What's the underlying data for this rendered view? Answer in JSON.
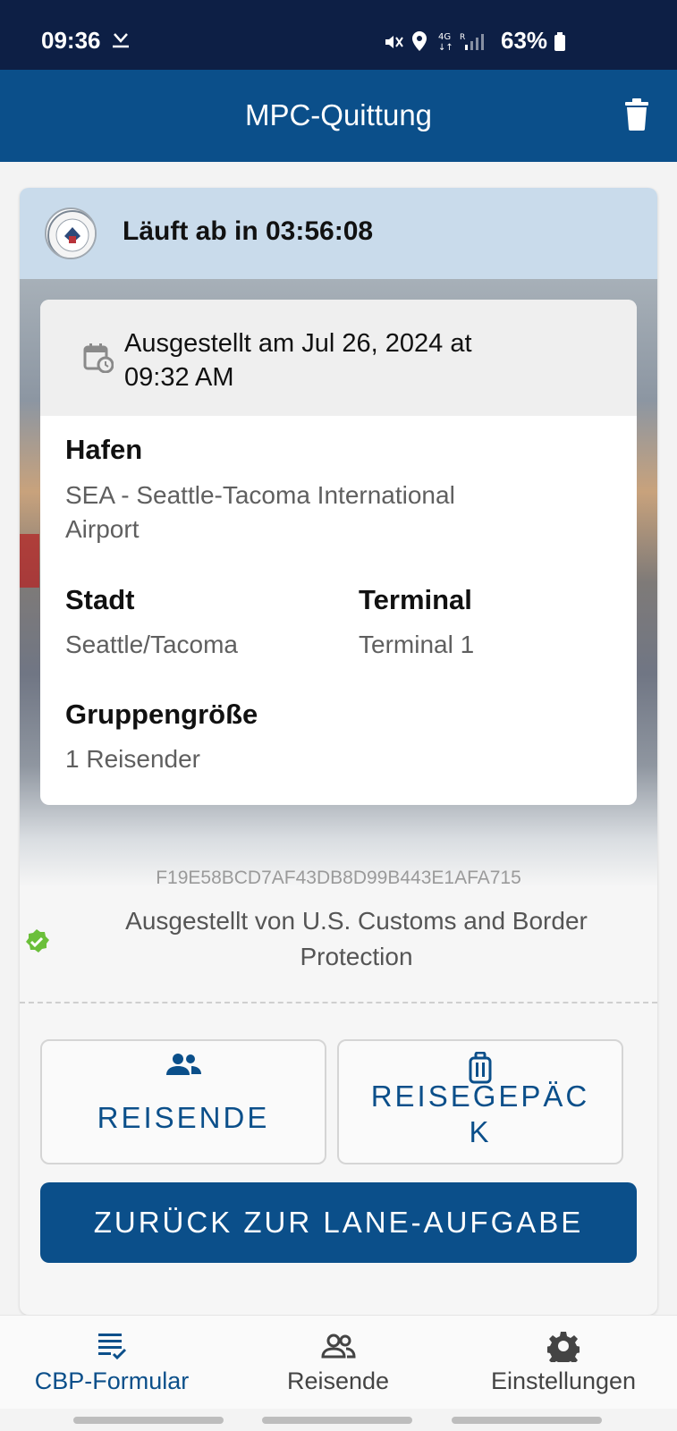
{
  "status_bar": {
    "time": "09:36",
    "battery": "63%"
  },
  "appbar": {
    "title": "MPC-Quittung"
  },
  "receipt": {
    "expires": "Läuft ab in 03:56:08",
    "issued_line1": "Ausgestellt am Jul 26, 2024 at",
    "issued_line2": "09:32 AM",
    "port_label": "Hafen",
    "port_value_line1": "SEA - Seattle-Tacoma International",
    "port_value_line2": "Airport",
    "city_label": "Stadt",
    "city_value": "Seattle/Tacoma",
    "terminal_label": "Terminal",
    "terminal_value": "Terminal 1",
    "group_label": "Gruppengröße",
    "group_value": "1 Reisender",
    "hash": "F19E58BCD7AF43DB8D99B443E1AFA715",
    "issuer_line1": "Ausgestellt von U.S. Customs and Border",
    "issuer_line2": "Protection"
  },
  "actions": {
    "travelers_label": "REISENDE",
    "luggage_line1": "REISEGEPÄC",
    "luggage_line2": "K",
    "back_label": "ZURÜCK ZUR LANE-AUFGABE"
  },
  "bottom_nav": {
    "items": [
      {
        "label": "CBP-Formular",
        "icon": "form-icon",
        "active": true
      },
      {
        "label": "Reisende",
        "icon": "people-icon",
        "active": false
      },
      {
        "label": "Einstellungen",
        "icon": "gear-icon",
        "active": false
      }
    ]
  },
  "colors": {
    "primary": "#0b4f8a",
    "status_bar": "#0d1f45",
    "header_tint": "#c9dbeb",
    "verify_green": "#6bbf3a"
  }
}
